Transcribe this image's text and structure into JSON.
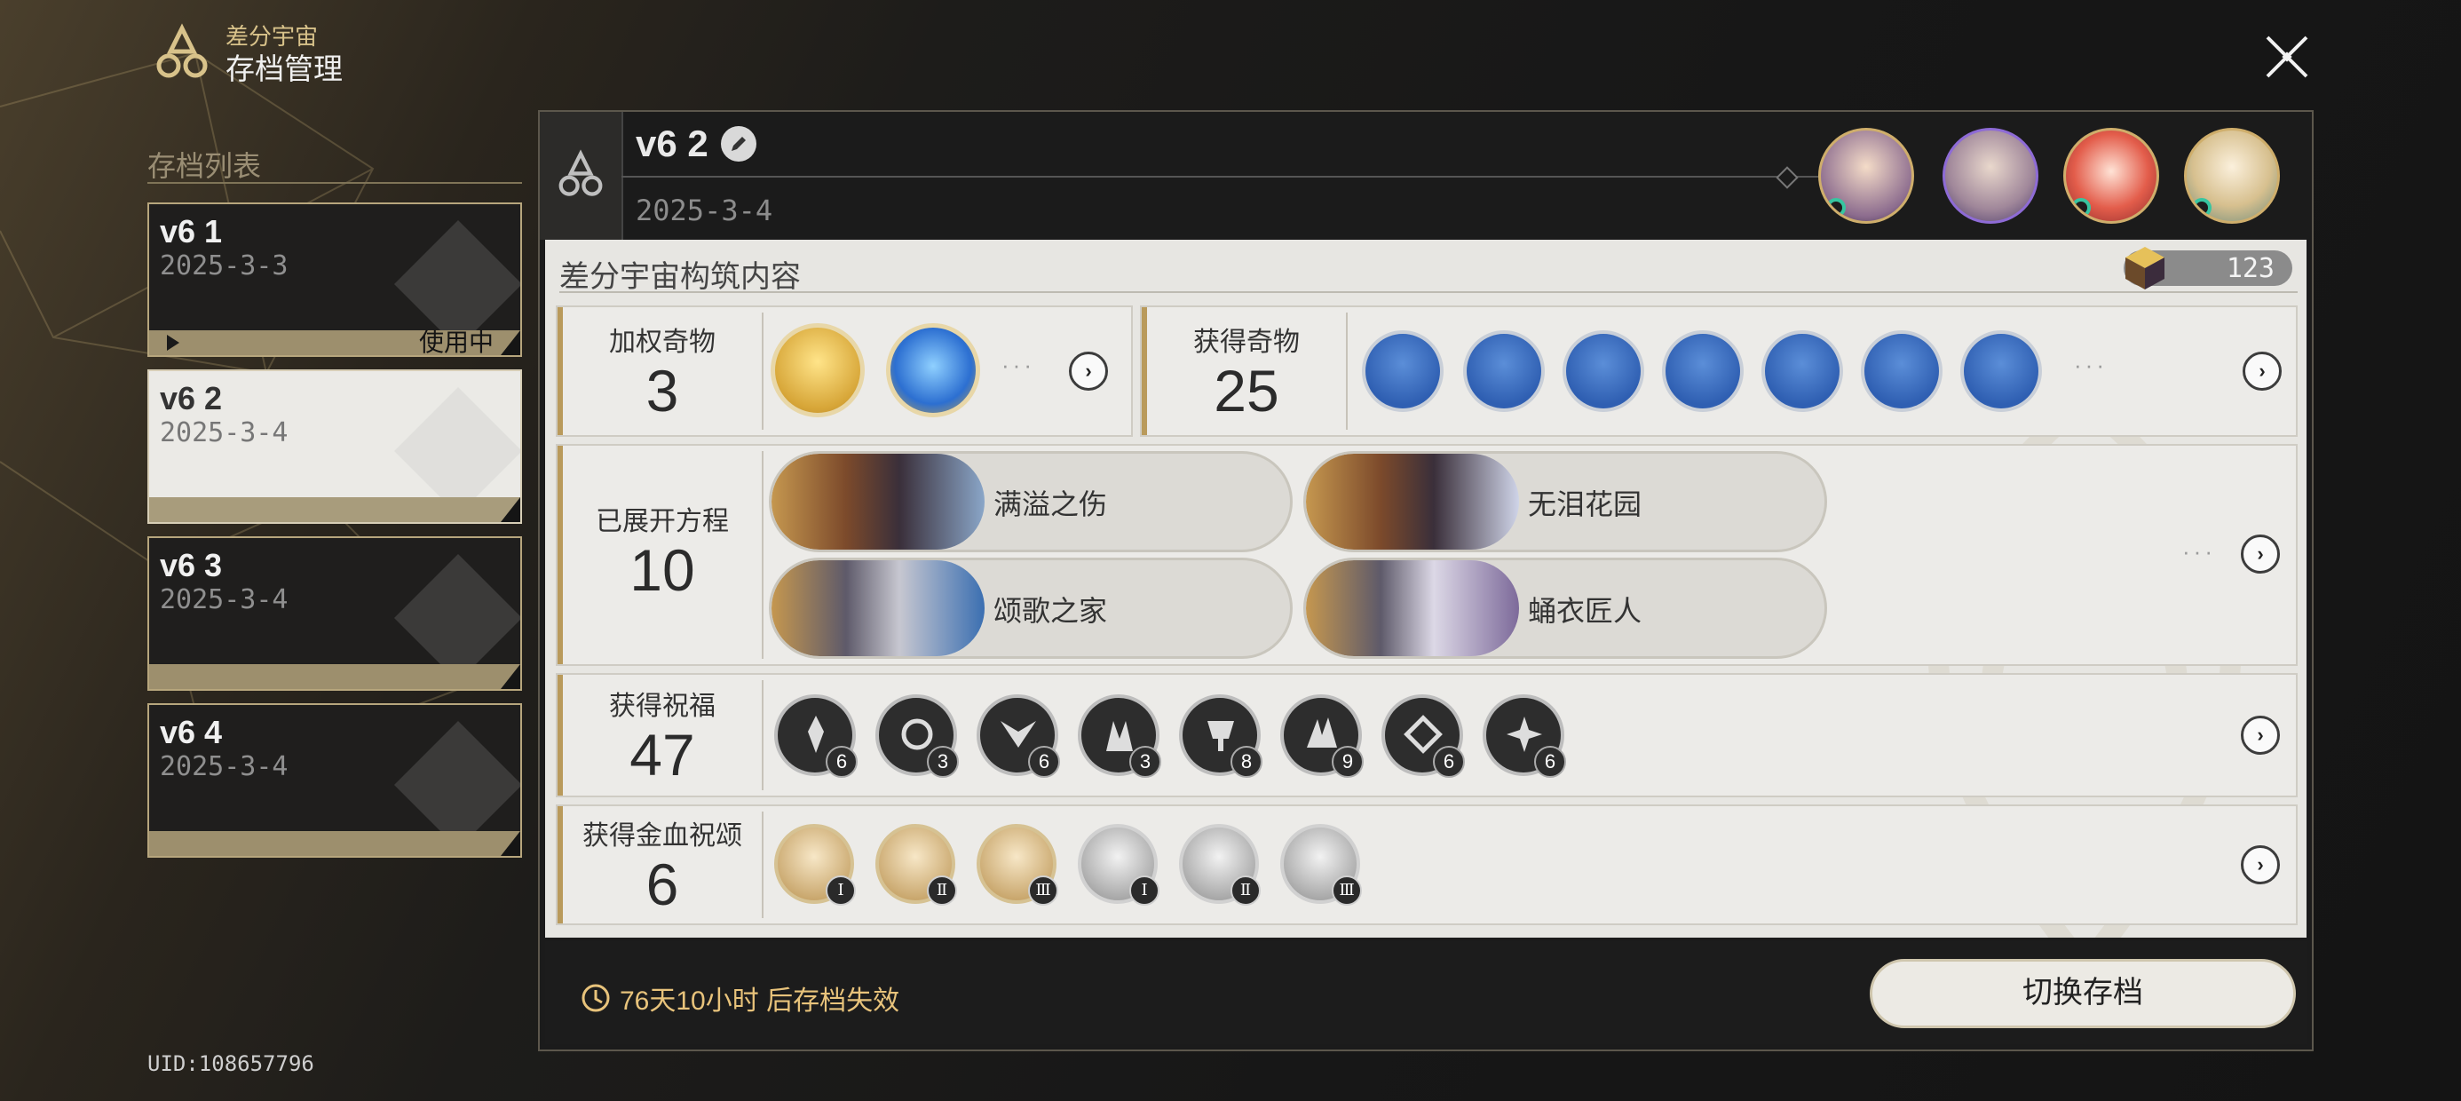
{
  "brand": {
    "line1": "差分宇宙",
    "line2": "存档管理"
  },
  "sidebar": {
    "title": "存档列表",
    "saves": [
      {
        "name": "v6 1",
        "date": "2025-3-3",
        "status": "使用中"
      },
      {
        "name": "v6 2",
        "date": "2025-3-4"
      },
      {
        "name": "v6 3",
        "date": "2025-3-4"
      },
      {
        "name": "v6 4",
        "date": "2025-3-4"
      }
    ]
  },
  "uid": "UID:108657796",
  "detail": {
    "title": "v6 2",
    "date": "2025-3-4",
    "section_title": "差分宇宙构筑内容",
    "badge_count": "123",
    "weighted_curios": {
      "label": "加权奇物",
      "value": "3"
    },
    "obtained_curios": {
      "label": "获得奇物",
      "value": "25"
    },
    "equations": {
      "label": "已展开方程",
      "value": "10",
      "items": [
        "满溢之伤",
        "无泪花园",
        "颂歌之家",
        "蛹衣匠人"
      ]
    },
    "blessings": {
      "label": "获得祝福",
      "value": "47",
      "counts": [
        "6",
        "3",
        "6",
        "3",
        "8",
        "9",
        "6",
        "6"
      ]
    },
    "golden_blood": {
      "label": "获得金血祝颂",
      "value": "6",
      "levels": [
        "Ⅰ",
        "Ⅱ",
        "Ⅲ",
        "Ⅰ",
        "Ⅱ",
        "Ⅲ"
      ]
    },
    "more_glyph": "···",
    "arrow_glyph": "›",
    "expire_text": "76天10小时 后存档失效",
    "switch_label": "切换存档"
  },
  "colors": {
    "accent": "#b99a5b",
    "gold": "#d8c28a",
    "warning": "#e8c37b"
  }
}
